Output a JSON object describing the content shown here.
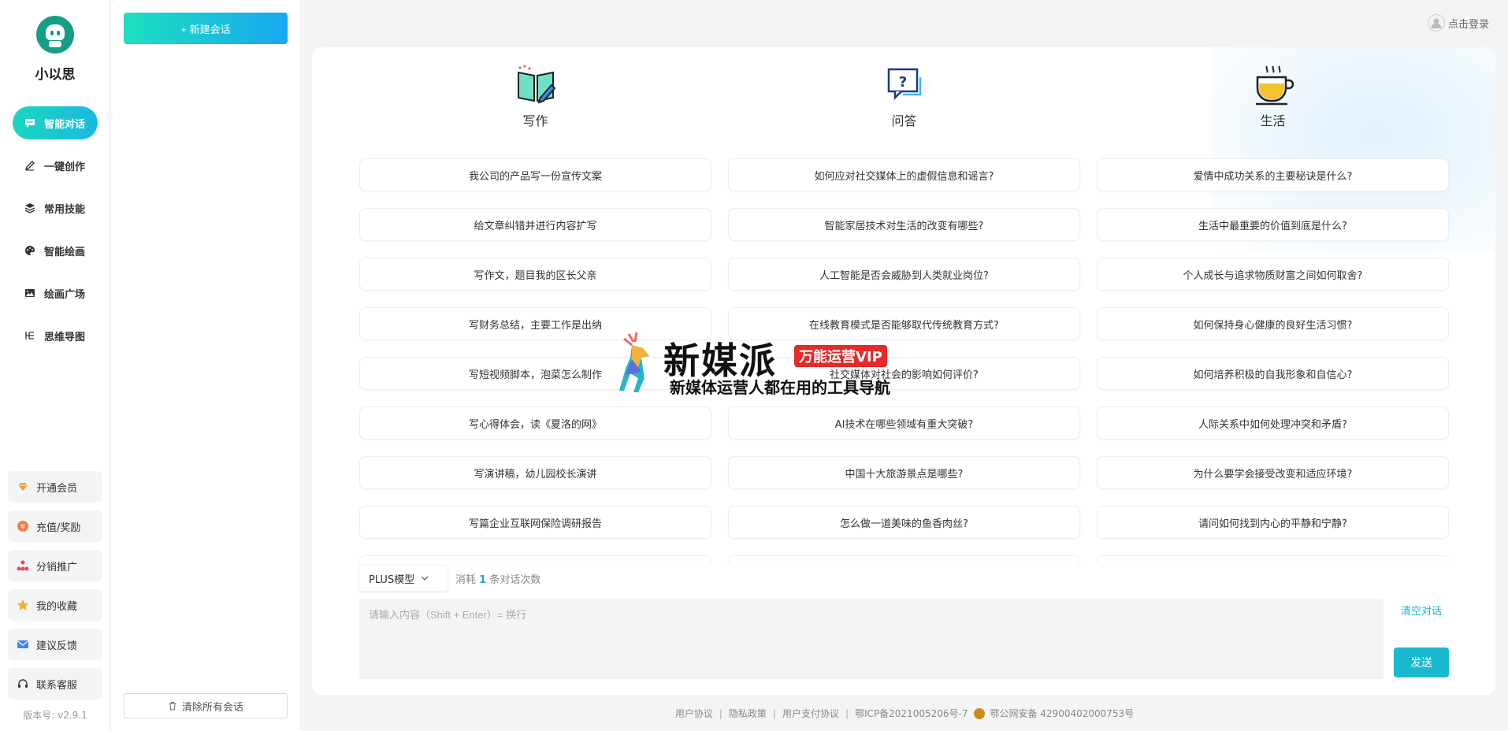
{
  "brand": {
    "name": "小以思"
  },
  "nav": {
    "items": [
      {
        "label": "智能对话",
        "icon": "chat-icon",
        "active": true
      },
      {
        "label": "一键创作",
        "icon": "pen-icon",
        "active": false
      },
      {
        "label": "常用技能",
        "icon": "layers-icon",
        "active": false
      },
      {
        "label": "智能绘画",
        "icon": "palette-icon",
        "active": false
      },
      {
        "label": "绘画广场",
        "icon": "image-icon",
        "active": false
      },
      {
        "label": "思维导图",
        "icon": "mindmap-icon",
        "active": false
      }
    ],
    "bottom": [
      {
        "label": "开通会员",
        "icon": "diamond-icon"
      },
      {
        "label": "充值/奖励",
        "icon": "coin-icon"
      },
      {
        "label": "分销推广",
        "icon": "network-icon"
      },
      {
        "label": "我的收藏",
        "icon": "star-icon"
      },
      {
        "label": "建议反馈",
        "icon": "mail-icon"
      },
      {
        "label": "联系客服",
        "icon": "headset-icon"
      }
    ],
    "version": "版本号: v2.9.1"
  },
  "conversations": {
    "new_label": "+ 新建会话",
    "clear_all_label": "清除所有会话"
  },
  "login": {
    "label": "点击登录"
  },
  "columns": [
    {
      "title": "写作",
      "icon": "book-pen-icon",
      "prompts": [
        "我公司的产品写一份宣传文案",
        "给文章纠错并进行内容扩写",
        "写作文，题目我的区长父亲",
        "写财务总结，主要工作是出纳",
        "写短视频脚本，泡菜怎么制作",
        "写心得体会，读《夏洛的网》",
        "写演讲稿，幼儿园校长演讲",
        "写篇企业互联网保险调研报告"
      ]
    },
    {
      "title": "问答",
      "icon": "question-chat-icon",
      "prompts": [
        "如何应对社交媒体上的虚假信息和谣言?",
        "智能家居技术对生活的改变有哪些?",
        "人工智能是否会威胁到人类就业岗位?",
        "在线教育模式是否能够取代传统教育方式?",
        "社交媒体对社会的影响如何评价?",
        "AI技术在哪些领域有重大突破?",
        "中国十大旅游景点是哪些?",
        "怎么做一道美味的鱼香肉丝?"
      ]
    },
    {
      "title": "生活",
      "icon": "coffee-cup-icon",
      "prompts": [
        "爱情中成功关系的主要秘诀是什么?",
        "生活中最重要的价值到底是什么?",
        "个人成长与追求物质财富之间如何取舍?",
        "如何保持身心健康的良好生活习惯?",
        "如何培养积极的自我形象和自信心?",
        "人际关系中如何处理冲突和矛盾?",
        "为什么要学会接受改变和适应环境?",
        "请问如何找到内心的平静和宁静?"
      ]
    }
  ],
  "composer": {
    "model": "PLUS模型",
    "consume_prefix": "消耗",
    "consume_count": "1",
    "consume_suffix": "条对话次数",
    "placeholder": "请输入内容（Shift + Enter）= 换行",
    "clear_label": "清空对话",
    "send_label": "发送"
  },
  "watermark": {
    "title": "新媒派",
    "badge": "万能运营VIP",
    "subtitle": "新媒体运营人都在用的工具导航"
  },
  "footer": {
    "user_agreement": "用户协议",
    "privacy": "隐私政策",
    "payment": "用户支付协议",
    "icp": "鄂ICP备2021005206号-7",
    "police": "鄂公网安备 42900402000753号"
  },
  "colors": {
    "accent": "#1ab9cd",
    "gradient_start": "#1dd6c0",
    "gradient_end": "#18a7f0"
  }
}
